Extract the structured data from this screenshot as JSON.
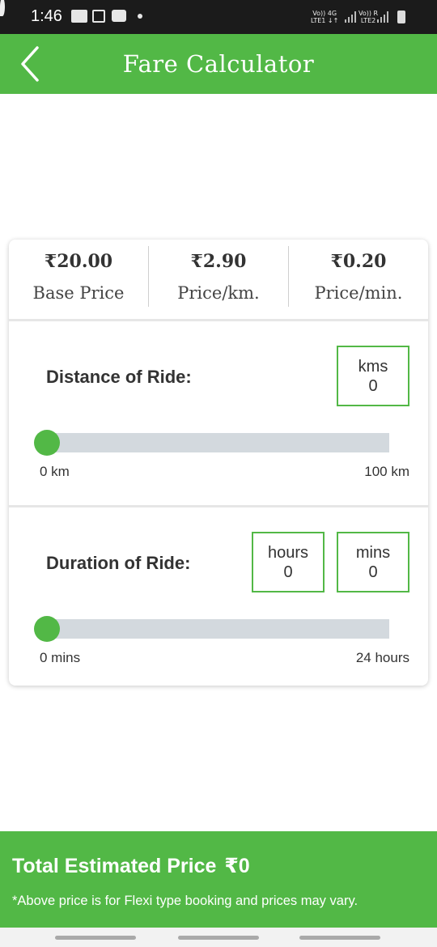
{
  "status_bar": {
    "time": "1:46",
    "network1": [
      "Vo)) 4G",
      "LTE1 ↓↑"
    ],
    "network2": [
      "Vo)) R",
      "LTE2"
    ]
  },
  "header": {
    "title": "Fare Calculator",
    "back_icon": "chevron-left-icon"
  },
  "prices": [
    {
      "amount": "₹20.00",
      "label": "Base Price"
    },
    {
      "amount": "₹2.90",
      "label": "Price/km."
    },
    {
      "amount": "₹0.20",
      "label": "Price/min."
    }
  ],
  "distance": {
    "title": "Distance of Ride:",
    "box_unit": "kms",
    "box_value": "0",
    "slider_min_label": "0 km",
    "slider_max_label": "100 km",
    "slider_value": 0
  },
  "duration": {
    "title": "Duration of Ride:",
    "hours_unit": "hours",
    "hours_value": "0",
    "mins_unit": "mins",
    "mins_value": "0",
    "slider_min_label": "0 mins",
    "slider_max_label": "24 hours",
    "slider_value": 0
  },
  "footer": {
    "total_label": "Total Estimated Price",
    "total_amount": "₹0",
    "note": "*Above price is for Flexi type booking and prices may vary."
  },
  "colors": {
    "accent": "#52b846",
    "status_bar": "#1b1b1b",
    "track": "#d3d9de"
  }
}
